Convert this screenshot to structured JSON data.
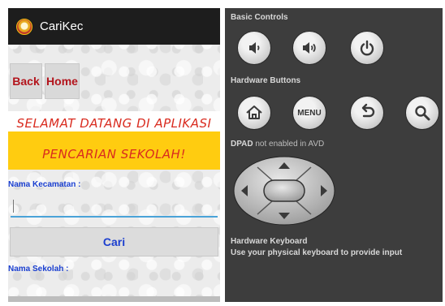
{
  "app": {
    "title": "CariKec",
    "back_label": "Back",
    "home_label": "Home",
    "banner_line1": "SELAMAT DATANG DI APLIKASI",
    "banner_line2": "PENCARIAN SEKOLAH!",
    "kecamatan_label": "Nama Kecamatan :",
    "kecamatan_value": "",
    "search_label": "Cari",
    "sekolah_label": "Nama Sekolah :"
  },
  "emulator": {
    "basic_controls_title": "Basic Controls",
    "hardware_buttons_title": "Hardware Buttons",
    "dpad_title": "DPAD",
    "dpad_suffix": " not enabled in AVD",
    "menu_label": "MENU",
    "keyboard_title": "Hardware Keyboard",
    "keyboard_desc": "Use your physical keyboard to provide input",
    "icons": [
      "volume-down-icon",
      "volume-up-icon",
      "power-icon",
      "home-icon",
      "back-arrow-icon",
      "search-icon",
      "dpad-icon"
    ]
  },
  "colors": {
    "action_bar": "#1d1d1d",
    "banner_yellow": "#ffcc10",
    "banner_text": "#d92b1f",
    "label_blue": "#1a3fd0",
    "button_red_text": "#b3141c",
    "emulator_bg": "#3d3d3d"
  }
}
